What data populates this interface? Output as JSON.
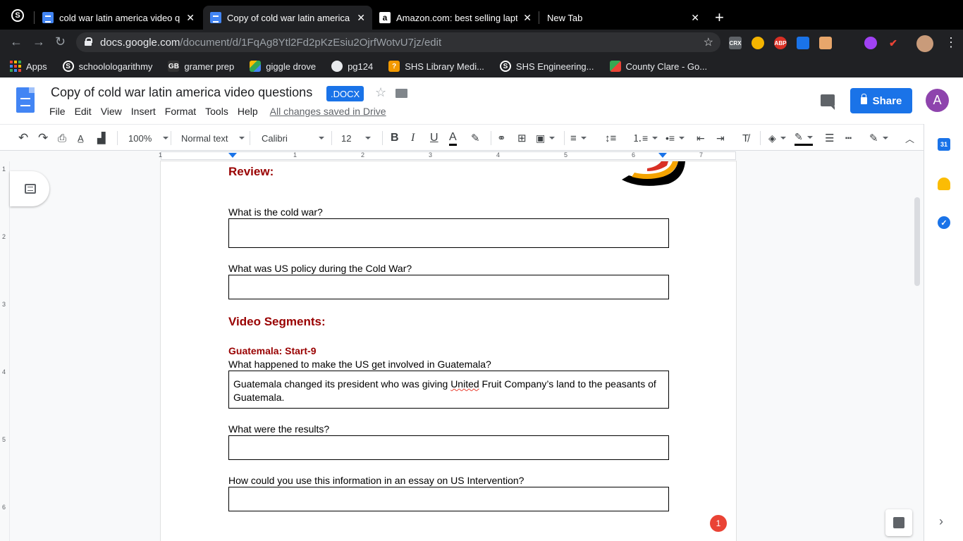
{
  "browser": {
    "tabs": [
      {
        "title": "cold war latin america video qu",
        "favicon": "docs-icon"
      },
      {
        "title": "Copy of cold war latin america",
        "favicon": "docs-icon",
        "active": true
      },
      {
        "title": "Amazon.com: best selling lapto",
        "favicon": "amazon-icon"
      },
      {
        "title": "New Tab",
        "favicon": ""
      }
    ],
    "url_host": "docs.google.com",
    "url_path": "/document/d/1FqAg8Ytl2Fd2pKzEsiu2OjrfWotvU7jz/edit",
    "extensions": [
      "CRX",
      "ABP"
    ],
    "bookmarks": [
      {
        "label": "Apps",
        "icon": "apps-grid-icon"
      },
      {
        "label": "schoolologarithmy",
        "icon": "schoology-icon"
      },
      {
        "label": "gramer prep",
        "icon": "gb-icon"
      },
      {
        "label": "giggle drove",
        "icon": "drive-icon"
      },
      {
        "label": "pg124",
        "icon": "globe-icon"
      },
      {
        "label": "SHS Library Medi...",
        "icon": "library-icon"
      },
      {
        "label": "SHS Engineering...",
        "icon": "schoology-icon"
      },
      {
        "label": "County Clare - Go...",
        "icon": "maps-icon"
      }
    ]
  },
  "docs": {
    "title": "Copy of cold war latin america video questions",
    "badge": ".DOCX",
    "menu": [
      "File",
      "Edit",
      "View",
      "Insert",
      "Format",
      "Tools",
      "Help"
    ],
    "save_status": "All changes saved in Drive",
    "share_label": "Share",
    "user_initial": "A"
  },
  "toolbar": {
    "zoom": "100%",
    "style": "Normal text",
    "font": "Calibri",
    "size": "12",
    "bold": "B",
    "italic": "I",
    "underline": "U",
    "text_color": "A"
  },
  "ruler": {
    "marks": [
      "1",
      "1",
      "2",
      "3",
      "4",
      "5",
      "6",
      "7"
    ],
    "vmarks": [
      "1",
      "2",
      "3",
      "4",
      "5",
      "6"
    ]
  },
  "document": {
    "review_heading": "Review:",
    "q1": "What is the cold war?",
    "q2": "What was US policy during the Cold War?",
    "segments_heading": "Video Segments:",
    "guatemala_heading": "Guatemala: Start-9",
    "q3": "What happened to make the US get involved in Guatemala?",
    "a3_before": "Guatemala changed its president who was giving ",
    "a3_misspelled": "United",
    "a3_after": " Fruit Company’s land to the peasants of Guatemala.",
    "q4": "What were the results?",
    "q5": "How could you use this information in an essay on US Intervention?"
  },
  "notifications": {
    "count": "1"
  },
  "colors": {
    "accent": "#1a73e8",
    "heading_red": "#990000",
    "avatar_purple": "#8e44ad",
    "badge_red": "#ea4335"
  }
}
